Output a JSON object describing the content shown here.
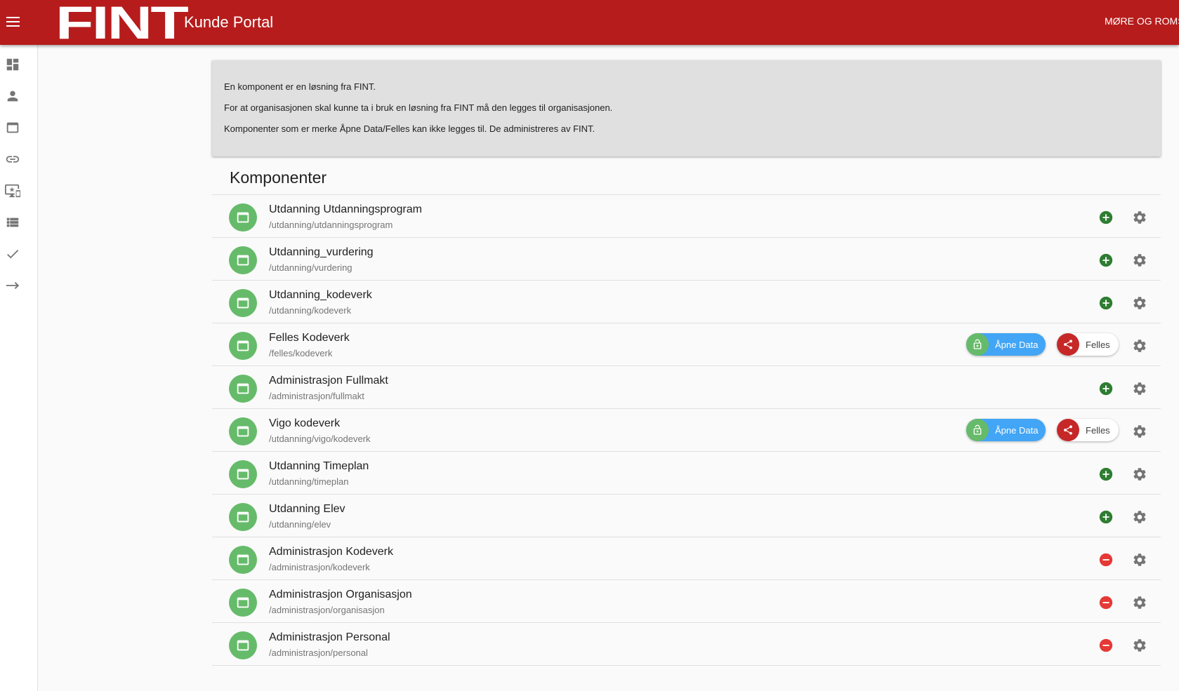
{
  "header": {
    "logo_text": "FINT",
    "title": "Kunde Portal",
    "organisation": "MØRE OG ROMSDAL"
  },
  "sidebar": {
    "items": [
      {
        "name": "dashboard",
        "icon": "dashboard-icon"
      },
      {
        "name": "contacts",
        "icon": "person-icon"
      },
      {
        "name": "components",
        "icon": "web-asset-icon"
      },
      {
        "name": "adapters",
        "icon": "link-icon"
      },
      {
        "name": "clients",
        "icon": "important-devices-icon"
      },
      {
        "name": "access",
        "icon": "view-list-icon"
      },
      {
        "name": "tests",
        "icon": "check-icon"
      },
      {
        "name": "forward",
        "icon": "arrow-right-icon"
      }
    ]
  },
  "info": {
    "line1": "En komponent er en løsning fra FINT.",
    "line2": "For at organisasjonen skal kunne ta i bruk en løsning fra FINT må den legges til organisasjonen.",
    "line3": "Komponenter som er merke Åpne Data/Felles kan ikke legges til. De administreres av FINT."
  },
  "components": {
    "title": "Komponenter",
    "open_data_label": "Åpne Data",
    "common_label": "Felles",
    "items": [
      {
        "name": "Utdanning Utdanningsprogram",
        "path": "/utdanning/utdanningsprogram",
        "state": "add"
      },
      {
        "name": "Utdanning_vurdering",
        "path": "/utdanning/vurdering",
        "state": "add"
      },
      {
        "name": "Utdanning_kodeverk",
        "path": "/utdanning/kodeverk",
        "state": "add"
      },
      {
        "name": "Felles Kodeverk",
        "path": "/felles/kodeverk",
        "state": "open"
      },
      {
        "name": "Administrasjon Fullmakt",
        "path": "/administrasjon/fullmakt",
        "state": "add"
      },
      {
        "name": "Vigo kodeverk",
        "path": "/utdanning/vigo/kodeverk",
        "state": "open"
      },
      {
        "name": "Utdanning Timeplan",
        "path": "/utdanning/timeplan",
        "state": "add"
      },
      {
        "name": "Utdanning Elev",
        "path": "/utdanning/elev",
        "state": "add"
      },
      {
        "name": "Administrasjon Kodeverk",
        "path": "/administrasjon/kodeverk",
        "state": "remove"
      },
      {
        "name": "Administrasjon Organisasjon",
        "path": "/administrasjon/organisasjon",
        "state": "remove"
      },
      {
        "name": "Administrasjon Personal",
        "path": "/administrasjon/personal",
        "state": "remove"
      }
    ]
  },
  "colors": {
    "appbar": "#b71c1c",
    "avatar": "#66bb6a",
    "add": "#2e7d32",
    "remove": "#e53935",
    "open_data_chip": "#42a5f5",
    "common_chip_icon": "#c62828"
  }
}
